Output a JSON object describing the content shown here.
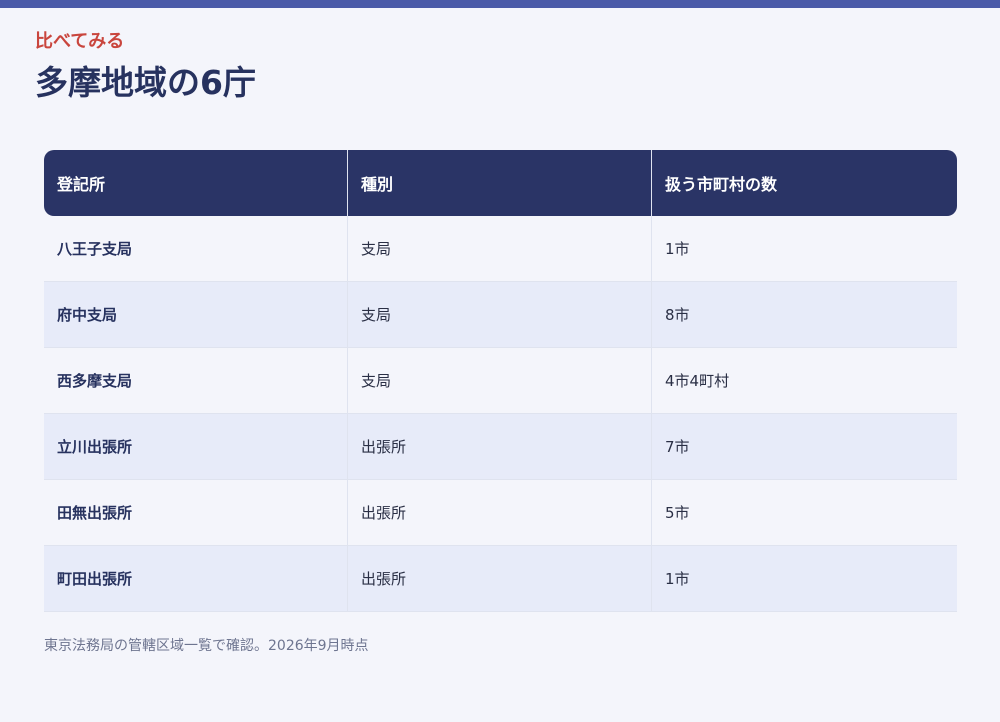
{
  "eyebrow": "比べてみる",
  "title": "多摩地域の6庁",
  "table": {
    "headers": [
      "登記所",
      "種別",
      "扱う市町村の数"
    ],
    "rows": [
      {
        "office": "八王子支局",
        "type": "支局",
        "count": "1市"
      },
      {
        "office": "府中支局",
        "type": "支局",
        "count": "8市"
      },
      {
        "office": "西多摩支局",
        "type": "支局",
        "count": "4市4町村"
      },
      {
        "office": "立川出張所",
        "type": "出張所",
        "count": "7市"
      },
      {
        "office": "田無出張所",
        "type": "出張所",
        "count": "5市"
      },
      {
        "office": "町田出張所",
        "type": "出張所",
        "count": "1市"
      }
    ]
  },
  "note": "東京法務局の管轄区域一覧で確認。2026年9月時点",
  "colors": {
    "accent_bar": "#4a5aa8",
    "eyebrow": "#c9453d",
    "title": "#27325f",
    "header_bg": "#2a3466",
    "row_alt_bg": "#e7ebf9"
  }
}
